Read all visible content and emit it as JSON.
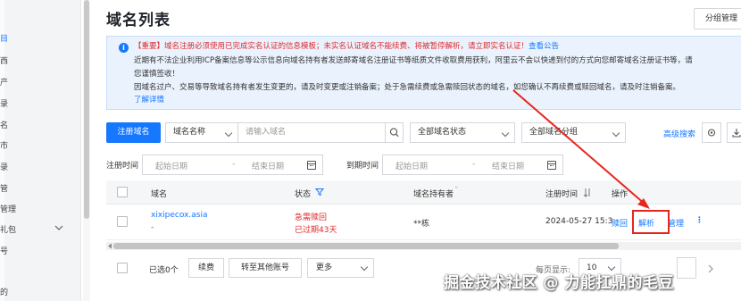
{
  "sidebar": {
    "items": [
      {
        "label": "目"
      },
      {
        "label": "西"
      },
      {
        "label": "产"
      },
      {
        "label": "录"
      },
      {
        "label": "名"
      },
      {
        "label": "市"
      },
      {
        "label": "录"
      },
      {
        "label": "管"
      },
      {
        "label": "管理"
      },
      {
        "label": "礼包"
      },
      {
        "label": "号"
      },
      {
        "label": "的"
      }
    ]
  },
  "header": {
    "title": "域名列表",
    "group_manage_label": "分组管理"
  },
  "notice": {
    "prefix": "【重要】域名注册必须使用已完成实名认证的信息模板；未实名认证域名不能续费、将被暂停解析，请立即实名认证！",
    "notice_link": "查看公告",
    "line2": "近期有不法企业利用ICP备案信息等公示信息向域名持有者发送邮寄域名注册证书等纸质文件收取费用获利，阿里云不会以快递到付的方式向您邮寄域名注册证书等，请",
    "line3": "您谨慎签收！",
    "line4": "因域名过户、交易等导致域名持有者发生变更的，请及时变更或注销备案；处于急需续费或急需赎回状态的域名，如您确认不再续费或赎回域名，请及时注销备案。",
    "learn_more": "了解详情"
  },
  "filters": {
    "register_label": "注册域名",
    "domain_name_select": "域名名称",
    "search_placeholder": "请输入域名",
    "status_select": "全部域名状态",
    "group_select": "全部域名分组",
    "advanced_search": "高级搜索",
    "reg_time_label": "注册时间",
    "start_date": "起始日期",
    "end_date": "结束日期",
    "expire_time_label": "到期时间",
    "start_date2": "起始日期",
    "end_date2": "结束日期",
    "dash": "-"
  },
  "table": {
    "columns": [
      "域名",
      "状态",
      "域名持有者",
      "注册时间",
      "操作"
    ],
    "rows": [
      {
        "domain": "xixipecox.asia",
        "domain_sub": "-",
        "status_main": "急需赎回",
        "status_sub": "已过期43天",
        "holder": "**栋",
        "reg_time": "2024-05-27 15:3",
        "actions": [
          "赎回",
          "解析",
          "管理",
          "⋮"
        ]
      }
    ]
  },
  "bottom": {
    "selected_text": "已选0个",
    "renew": "续费",
    "transfer": "转至其他账号",
    "more": "更多",
    "page_size_label": "每页显示:",
    "page_size": "10"
  },
  "watermark": "掘金技术社区 @ 力能扛鼎的毛豆",
  "colors": {
    "accent": "#1677ff",
    "danger": "#e0292c",
    "annotation": "#e5261e"
  }
}
